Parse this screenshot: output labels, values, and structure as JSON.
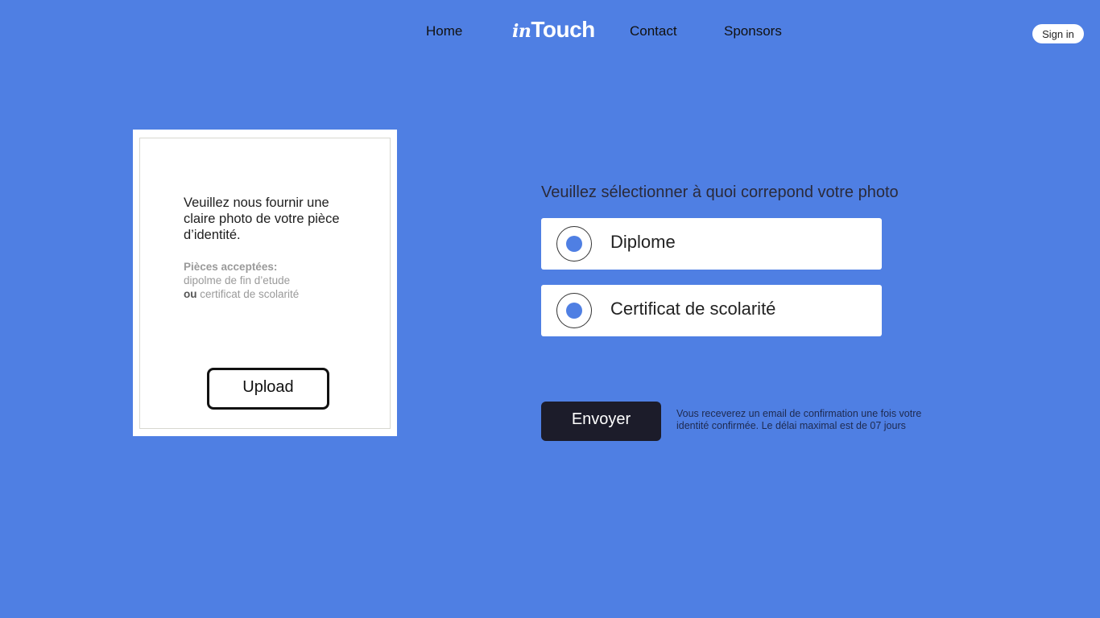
{
  "nav": {
    "home": "Home",
    "logo_prefix": "in",
    "logo_main": "Touch",
    "contact": "Contact",
    "sponsors": "Sponsors",
    "sign_in": "Sign in"
  },
  "upload_card": {
    "instruction": "Veuillez nous fournir une claire photo de votre pièce d’identité.",
    "accepted_label": "Pièces acceptées:",
    "accepted_item_1": "dipolme de fin d’etude",
    "or_word": "ou",
    "accepted_item_2": "certificat de scolarité",
    "upload_button": "Upload"
  },
  "selection": {
    "prompt": "Veuillez sélectionner à quoi correpond votre photo",
    "options": [
      {
        "label": "Diplome",
        "selected": true
      },
      {
        "label": "Certificat de scolarité",
        "selected": true
      }
    ]
  },
  "submit": {
    "button": "Envoyer",
    "note": "Vous receverez un email de confirmation une fois votre identité confirmée. Le délai maximal est de 07 jours"
  },
  "colors": {
    "background": "#4f7fe3",
    "button_dark": "#1c1c2a",
    "radio_fill": "#4f7fe3"
  }
}
